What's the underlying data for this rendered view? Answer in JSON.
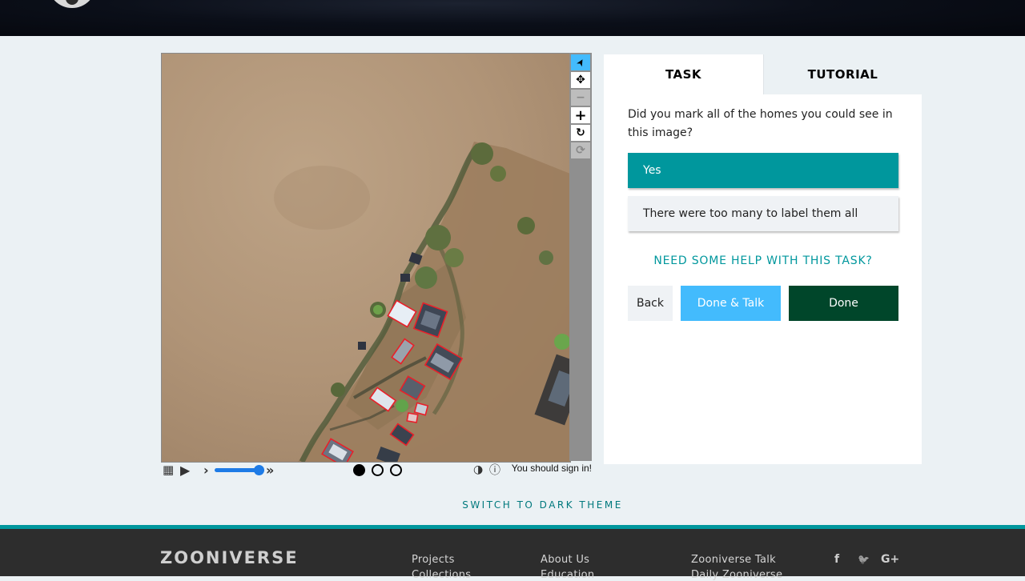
{
  "viewer": {
    "tools": [
      {
        "name": "pointer-icon",
        "glyph": "➤",
        "state": "active"
      },
      {
        "name": "move-icon",
        "glyph": "✥",
        "state": "normal"
      },
      {
        "name": "zoom-out-icon",
        "glyph": "−",
        "state": "disabled"
      },
      {
        "name": "zoom-in-icon",
        "glyph": "+",
        "state": "normal"
      },
      {
        "name": "rotate-icon",
        "glyph": "↻",
        "state": "normal"
      },
      {
        "name": "reset-icon",
        "glyph": "⟳",
        "state": "disabled"
      }
    ],
    "controls": {
      "grid_glyph": "▦",
      "play_glyph": "▶",
      "step_glyph": "›",
      "fast_glyph": "»",
      "contrast_glyph": "◑",
      "info_glyph": "ⓘ",
      "signin_text": "You should sign in!",
      "frames": 3,
      "current_frame": 1,
      "speed_level": 1.0
    }
  },
  "task_panel": {
    "tabs": [
      "TASK",
      "TUTORIAL"
    ],
    "active_tab": "TASK",
    "question": "Did you mark all of the homes you could see in this image?",
    "answers": [
      {
        "label": "Yes",
        "selected": true
      },
      {
        "label": "There were too many to label them all",
        "selected": false
      }
    ],
    "help_link": "NEED SOME HELP WITH THIS TASK?",
    "buttons": {
      "back": "Back",
      "done_talk": "Done & Talk",
      "done": "Done"
    }
  },
  "theme_switch": "SWITCH TO DARK THEME",
  "footer": {
    "brand": "ZOONIVERSE",
    "links": [
      "Projects",
      "Collections",
      "About Us",
      "Education",
      "Zooniverse Talk",
      "Daily Zooniverse"
    ],
    "social": [
      "f",
      "🐦",
      "G+"
    ]
  },
  "colors": {
    "accent": "#00979d",
    "done_dark": "#00462a",
    "talk_blue": "#43bbfd",
    "box_red": "#e8202a"
  }
}
